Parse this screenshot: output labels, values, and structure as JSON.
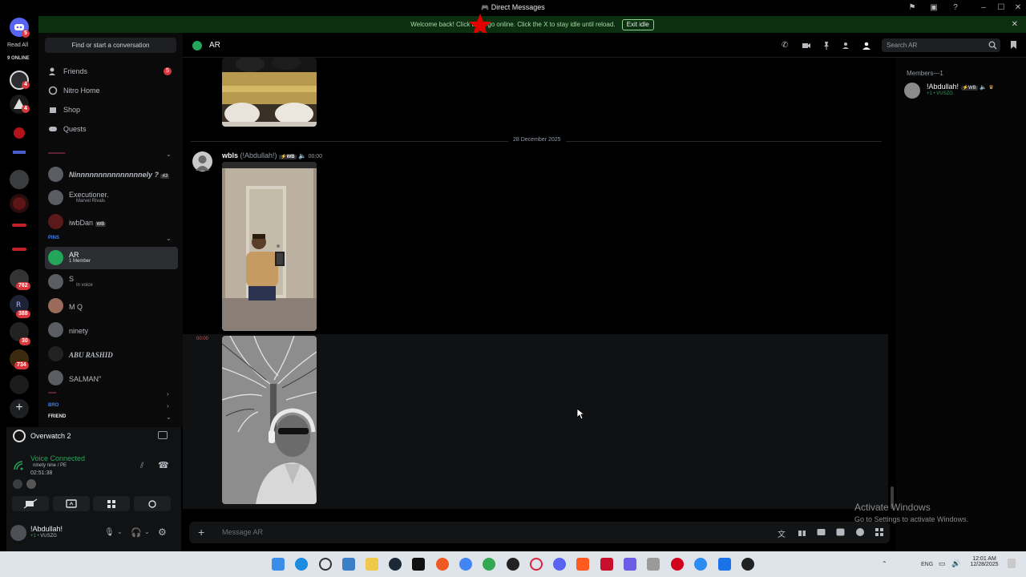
{
  "window": {
    "title": "Direct Messages"
  },
  "banner": {
    "text": "Welcome back! Click the L     go online. Click the X to stay idle until reload.",
    "exit_label": "Exit idle"
  },
  "rail": {
    "read_all": "Read All",
    "online": "9 ONLINE",
    "badges": [
      "5",
      "4",
      "4",
      "762",
      "388",
      "30",
      "734"
    ]
  },
  "dm": {
    "search_placeholder": "Find or start a conversation",
    "nav": [
      {
        "label": "Friends",
        "badge": "5",
        "icon": "friends-icon"
      },
      {
        "label": "Nitro Home",
        "icon": "nitro-icon"
      },
      {
        "label": "Shop",
        "icon": "shop-icon"
      },
      {
        "label": "Quests",
        "icon": "quests-icon"
      }
    ],
    "group1_label": "·····················",
    "conversations": [
      {
        "name": "Ninnnnnnnnnnnnnnnely ? ",
        "tag": "43"
      },
      {
        "name": "Executioner.",
        "sub": "Marvel Rivals"
      },
      {
        "name": "iwbDan",
        "tag": "WB"
      }
    ],
    "pins_label": "PINS",
    "pinned": [
      {
        "name": "AR",
        "sub": "1 Member"
      },
      {
        "name": "S",
        "sub": "In voice"
      },
      {
        "name": "M Q"
      },
      {
        "name": "ninety"
      },
      {
        "name": "ABU RASHID"
      },
      {
        "name": "SALMAN\""
      }
    ],
    "group2_label": "··········",
    "bro_label": "BRO",
    "friend_label": "FRIEND"
  },
  "voice": {
    "activity": "Overwatch 2",
    "status": "Voice Connected",
    "channel": "ninety nine / PE",
    "timer": "02:51:38"
  },
  "user": {
    "name": "!Abdullah!",
    "tag": "VUSZG",
    "sub": "+1 • "
  },
  "chat": {
    "channel_name": "AR",
    "search_placeholder": "Search AR",
    "date_divider": "28 December 2025",
    "message": {
      "author": "wbls",
      "nick": "(!Abdullah!)",
      "tag": "WB",
      "time": "00:00",
      "hover_time": "00:00"
    },
    "composer_placeholder": "Message AR"
  },
  "members": {
    "header": "Members—1",
    "list": [
      {
        "name": "!Abdullah!",
        "tag": "WB",
        "sub": "+1 • VUSZG"
      }
    ]
  },
  "watermark": {
    "title": "Activate Windows",
    "subtitle": "Go to Settings to activate Windows."
  },
  "taskbar": {
    "time": "12:01 AM",
    "date": "12/28/2025",
    "lang": "ENG"
  },
  "colors": {
    "accent_green": "#23a55a",
    "badge_red": "#da373c",
    "banner_bg": "#0b2f10"
  }
}
